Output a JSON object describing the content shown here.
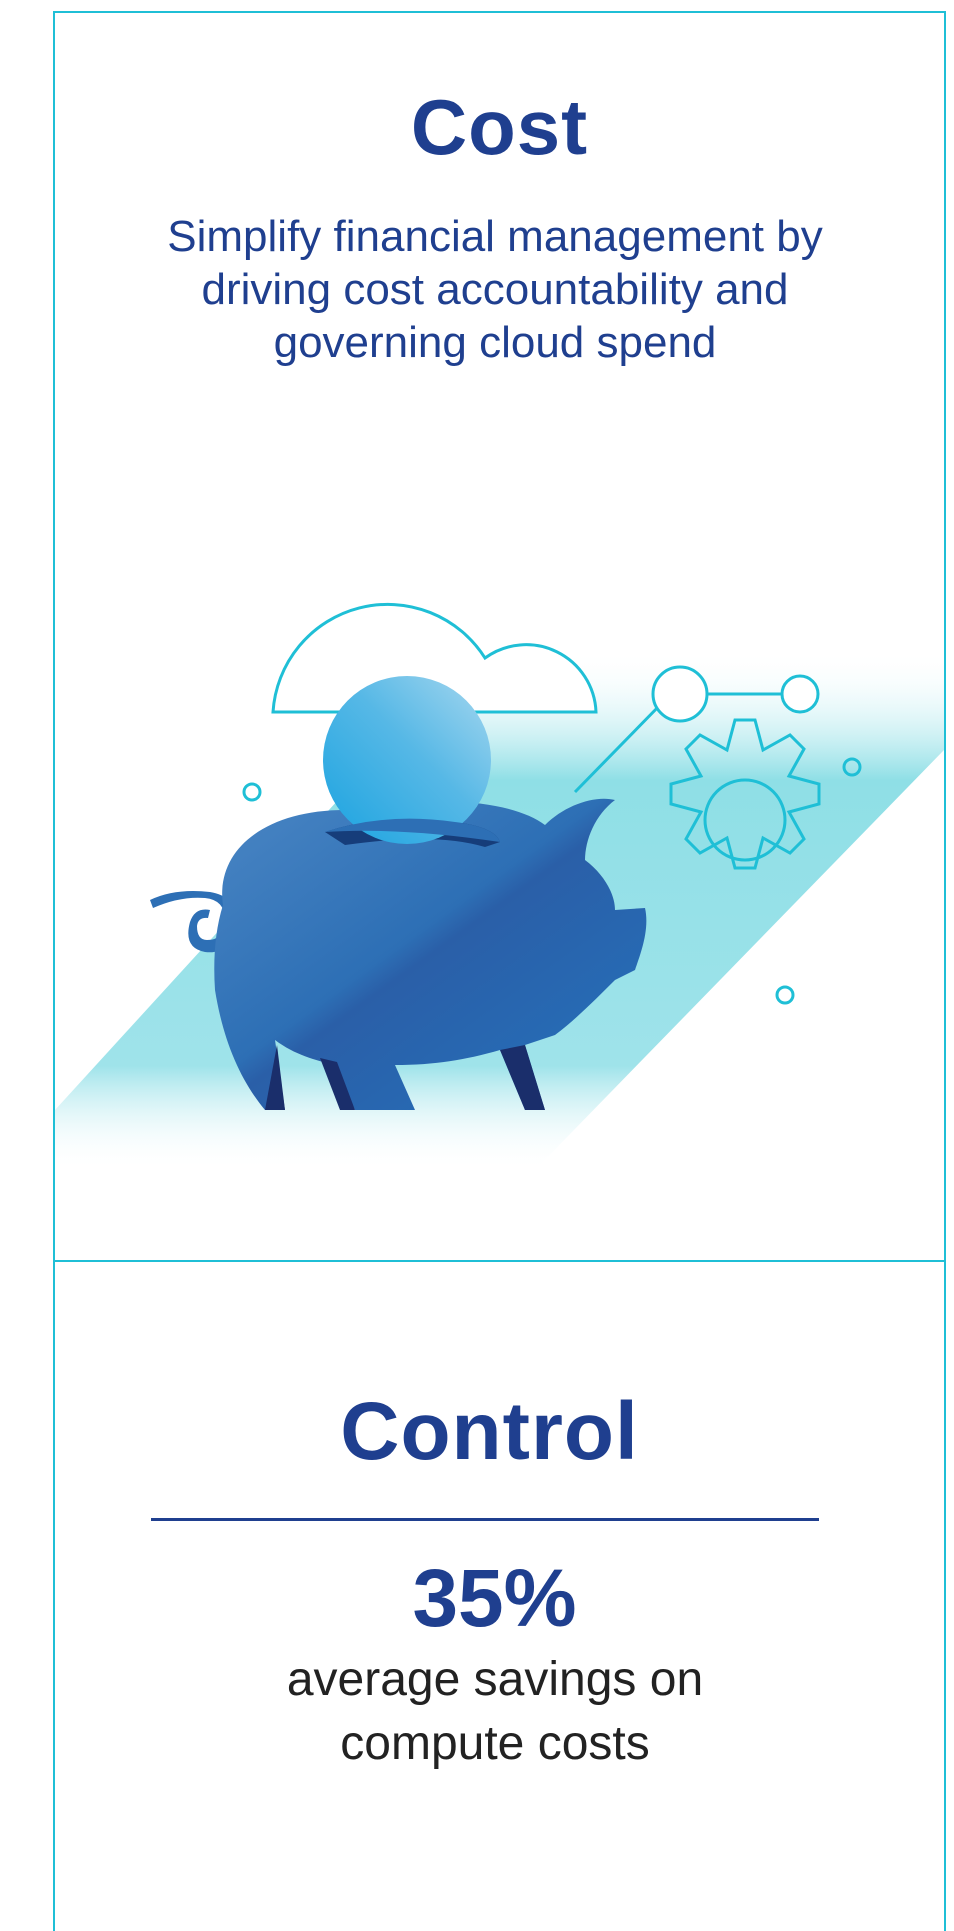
{
  "colors": {
    "border": "#1fbfd6",
    "heading": "#1f3f8f",
    "body_text": "#222222",
    "accent_teal": "#7fdbe3",
    "pig_blue": "#1f6fbf"
  },
  "cost_section": {
    "title": "Cost",
    "description": "Simplify financial management by driving cost accountability and governing cloud spend",
    "illustration": {
      "icons": [
        "piggy-bank-icon",
        "coin-icon",
        "cloud-icon",
        "gear-icon",
        "network-nodes-icon"
      ]
    }
  },
  "control_section": {
    "title": "Control",
    "stat_value": "35%",
    "stat_caption": "average savings on compute costs"
  }
}
